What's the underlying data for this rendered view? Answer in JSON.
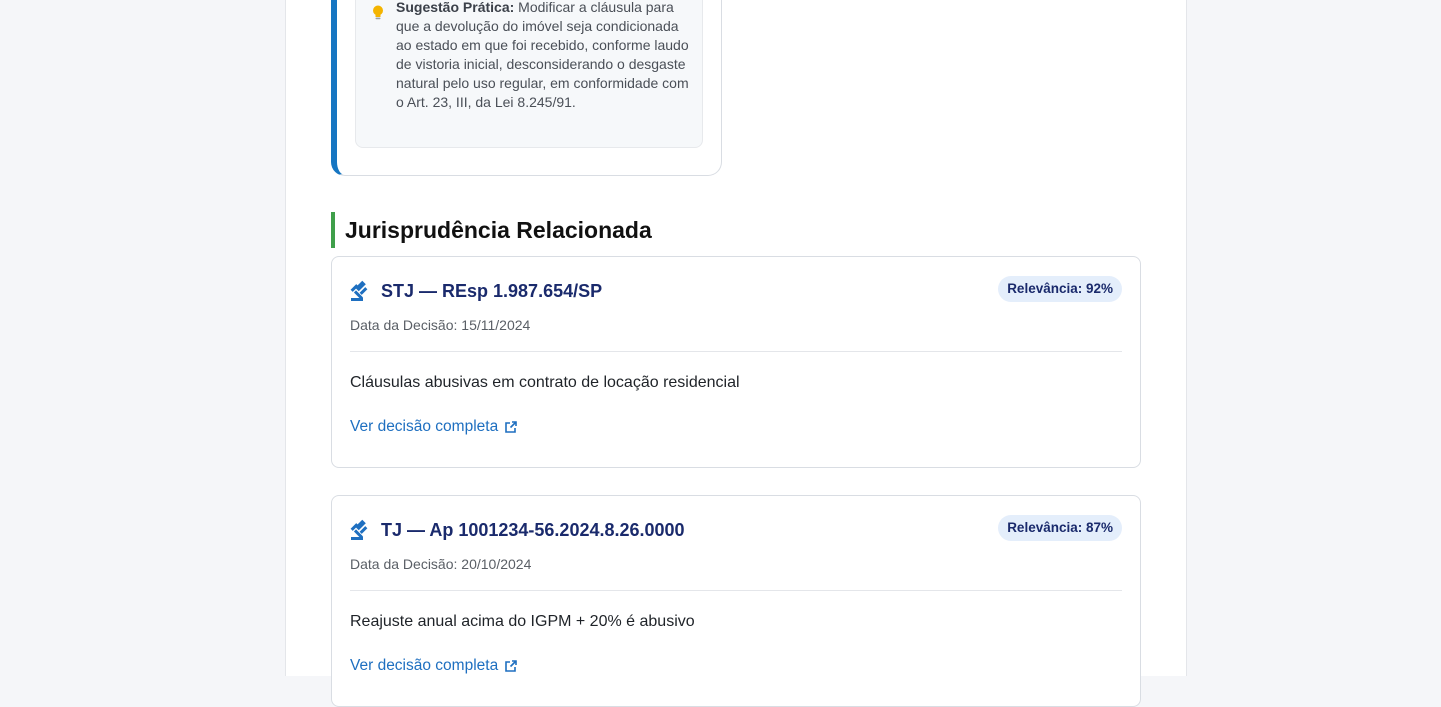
{
  "suggestion": {
    "label": "Sugestão Prática:",
    "text": "Modificar a cláusula para que a devolução do imóvel seja condicionada ao estado em que foi recebido, conforme laudo de vistoria inicial, desconsiderando o desgaste natural pelo uso regular, em conformidade com o Art. 23, III, da Lei 8.245/91.",
    "icon": "lightbulb-icon"
  },
  "section": {
    "title": "Jurisprudência Relacionada"
  },
  "cases": [
    {
      "title": "STJ — REsp 1.987.654/SP",
      "relevance": "Relevância: 92%",
      "date": "Data da Decisão: 15/11/2024",
      "summary": "Cláusulas abusivas em contrato de locação residencial",
      "link_label": "Ver decisão completa"
    },
    {
      "title": "TJ — Ap 1001234-56.2024.8.26.0000",
      "relevance": "Relevância: 87%",
      "date": "Data da Decisão: 20/10/2024",
      "summary": "Reajuste anual acima do IGPM + 20% é abusivo",
      "link_label": "Ver decisão completa"
    }
  ],
  "colors": {
    "accent_blue": "#1676c2",
    "section_green": "#3f9f4a",
    "title_navy": "#1a2a6c",
    "link_blue": "#1e6fc0",
    "bulb_yellow": "#f4b400"
  }
}
